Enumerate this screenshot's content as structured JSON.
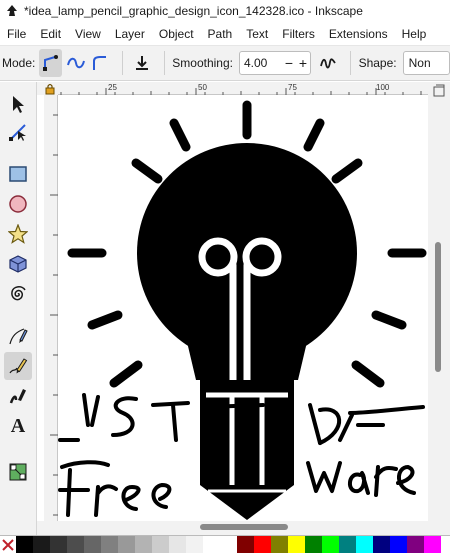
{
  "window": {
    "title": "*idea_lamp_pencil_graphic_design_icon_142328.ico - Inkscape"
  },
  "menu": [
    "File",
    "Edit",
    "View",
    "Layer",
    "Object",
    "Path",
    "Text",
    "Filters",
    "Extensions",
    "Help"
  ],
  "tool_controls": {
    "mode_label": "Mode:",
    "smoothing_label": "Smoothing:",
    "smoothing_value": "4.00",
    "minus": "−",
    "plus": "+",
    "shape_label": "Shape:",
    "shape_value": "Non"
  },
  "toolbox": {
    "tools": [
      "selector-tool",
      "node-tool",
      "rect-tool",
      "ellipse-tool",
      "star-tool",
      "3dbox-tool",
      "spiral-tool",
      "pen-tool",
      "pencil-tool",
      "calligraphy-tool",
      "text-tool",
      "gradient-tool"
    ],
    "active": "pencil-tool",
    "text_tool_glyph": "A"
  },
  "ruler": {
    "ticks": [
      "25",
      "50",
      "75",
      "100"
    ]
  },
  "palette": {
    "colors": [
      "#000000",
      "#1a1a1a",
      "#333333",
      "#4d4d4d",
      "#666666",
      "#808080",
      "#999999",
      "#b3b3b3",
      "#cccccc",
      "#e6e6e6",
      "#f2f2f2",
      "#ffffff",
      "#ffffff",
      "#800000",
      "#ff0000",
      "#808000",
      "#ffff00",
      "#008000",
      "#00ff00",
      "#008080",
      "#00ffff",
      "#000080",
      "#0000ff",
      "#800080",
      "#ff00ff"
    ]
  },
  "accent": "#2a5bd7"
}
